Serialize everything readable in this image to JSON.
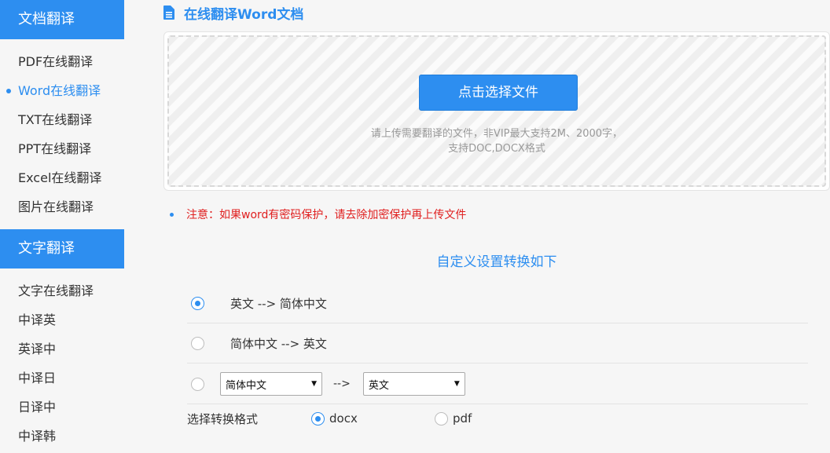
{
  "sidebar": {
    "section1_title": "文档翻译",
    "section1_items": [
      {
        "label": "PDF在线翻译"
      },
      {
        "label": "Word在线翻译"
      },
      {
        "label": "TXT在线翻译"
      },
      {
        "label": "PPT在线翻译"
      },
      {
        "label": "Excel在线翻译"
      },
      {
        "label": "图片在线翻译"
      }
    ],
    "section2_title": "文字翻译",
    "section2_items": [
      {
        "label": "文字在线翻译"
      },
      {
        "label": "中译英"
      },
      {
        "label": "英译中"
      },
      {
        "label": "中译日"
      },
      {
        "label": "日译中"
      },
      {
        "label": "中译韩"
      }
    ]
  },
  "main": {
    "title": "在线翻译Word文档",
    "upload": {
      "button_label": "点击选择文件",
      "hint_line1": "请上传需要翻译的文件，非VIP最大支持2M、2000字，",
      "hint_line2": "支持DOC,DOCX格式"
    },
    "notice": "注意：如果word有密码保护，请去除加密保护再上传文件",
    "settings_title": "自定义设置转换如下",
    "options": {
      "option1": "英文 --> 简体中文",
      "option2": "简体中文 --> 英文",
      "custom_from": "简体中文",
      "custom_arrow": "-->",
      "custom_to": "英文",
      "selected": "option1"
    },
    "format": {
      "label": "选择转换格式",
      "docx": "docx",
      "pdf": "pdf",
      "selected": "docx"
    }
  },
  "colors": {
    "accent": "#2d8ef0",
    "notice": "#e02020"
  }
}
